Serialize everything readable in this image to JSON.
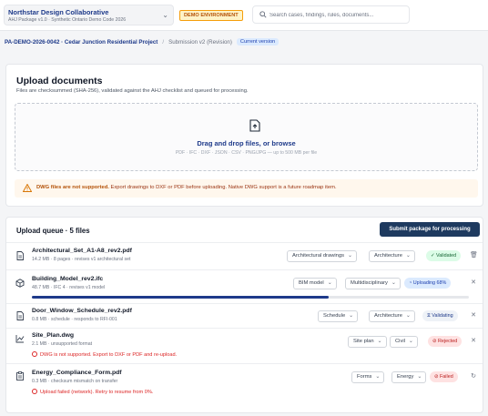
{
  "header": {
    "org_title": "Northstar Design Collaborative",
    "org_subtitle": "AHJ Package v1.0 · Synthetic Ontario Demo Code 2026",
    "env_badge": "DEMO ENVIRONMENT",
    "search_placeholder": "Search cases, findings, rules, documents..."
  },
  "breadcrumb": {
    "project": "PA-DEMO-2026-0042 · Cedar Junction Residential Project",
    "separator": "/",
    "submission": "Submission v2 (Revision)",
    "badge": "Current version"
  },
  "upload": {
    "title": "Upload documents",
    "description": "Files are checksummed (SHA-256), validated against the AHJ checklist and queued for processing.",
    "dropzone_title": "Drag and drop files, or browse",
    "dropzone_formats": "PDF · IFC · DXF · JSON · CSV · PNG/JPG — up to 500 MB per file",
    "warning_bold": "DWG files are not supported.",
    "warning_text": " Export drawings to DXF or PDF before uploading. Native DWG support is a future roadmap item."
  },
  "queue": {
    "title": "Upload queue · 5 files",
    "submit_label": "Submit package for processing",
    "items": [
      {
        "name": "Architectural_Set_A1-A8_rev2.pdf",
        "meta": "14.2 MB · 8 pages · revises v1 architectural set",
        "type": "Architectural drawings",
        "discipline": "Architecture",
        "status": "Validated",
        "action": "🗑",
        "error": "",
        "progress": 1
      },
      {
        "name": "Building_Model_rev2.ifc",
        "meta": "48.7 MB · IFC 4 · revises v1 model",
        "type": "BIM model",
        "discipline": "Multidisciplinary",
        "status": "Uploading 68%",
        "action": "✕",
        "error": "",
        "progress": 0.68
      },
      {
        "name": "Door_Window_Schedule_rev2.pdf",
        "meta": "0.8 MB · schedule · responds to RFI-001",
        "type": "Schedule",
        "discipline": "Architecture",
        "status": "Validating",
        "action": "✕",
        "error": "",
        "progress": 1
      },
      {
        "name": "Site_Plan.dwg",
        "meta": "2.1 MB · unsupported format",
        "type": "Site plan",
        "discipline": "Civil",
        "status": "Rejected",
        "action": "✕",
        "error": "DWG is not supported. Export to DXF or PDF and re-upload.",
        "progress": 0
      },
      {
        "name": "Energy_Compliance_Form.pdf",
        "meta": "0.3 MB · checksum mismatch on transfer",
        "type": "Forms",
        "discipline": "Energy",
        "status": "Failed",
        "action": "↻",
        "error": "Upload failed (network). Retry to resume from 0%.",
        "progress": 0
      }
    ]
  }
}
